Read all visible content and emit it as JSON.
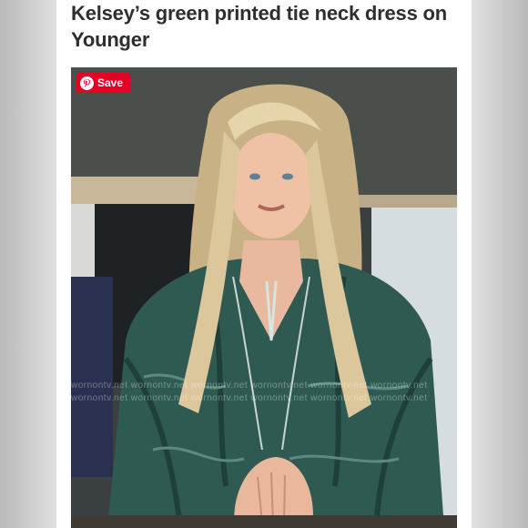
{
  "article": {
    "title": "Kelsey’s green printed tie neck dress on Younger"
  },
  "save_button": {
    "label": "Save",
    "icon": "pinterest-icon",
    "color": "#e60023"
  },
  "watermark": {
    "text": "wornontv.net  wornontv.net  wornontv.net  wornontv.net  wornontv.net  wornontv.net"
  },
  "colors": {
    "dress": "#2f5a52",
    "hair": "#d8c49a",
    "background": "#3b4142"
  }
}
